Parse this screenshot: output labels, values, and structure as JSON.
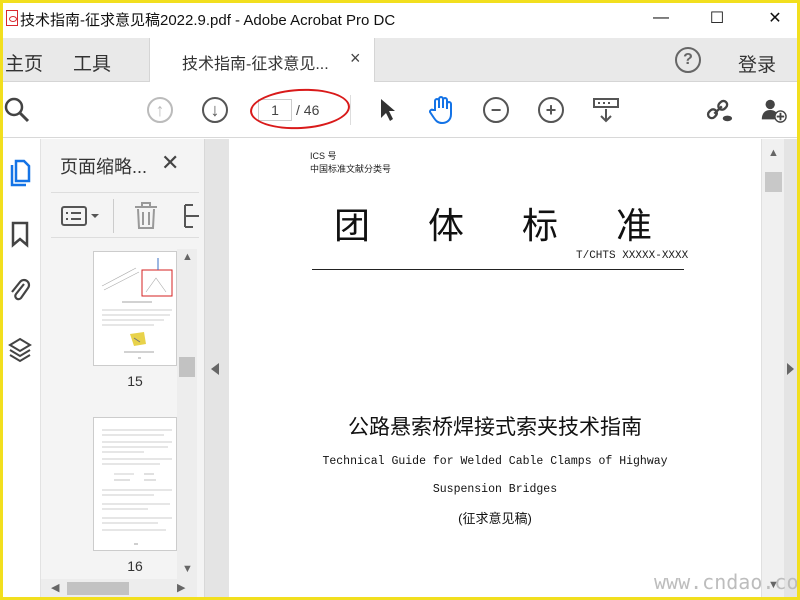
{
  "window": {
    "title": "技术指南-征求意见稿2022.9.pdf - Adobe Acrobat Pro DC",
    "minimize_glyph": "—",
    "maximize_glyph": "☐",
    "close_glyph": "✕"
  },
  "tabs": {
    "home": "主页",
    "tools": "工具",
    "document": "技术指南-征求意见...",
    "doc_close": "×",
    "help": "?",
    "login": "登录"
  },
  "toolbar": {
    "current_page": "1",
    "total_pages": "/ 46",
    "icons": [
      "search-icon",
      "previous-page-icon",
      "next-page-icon",
      "select-cursor-icon",
      "hand-tool-icon",
      "zoom-out-icon",
      "zoom-in-icon",
      "page-display-icon",
      "share-link-icon",
      "add-user-icon"
    ]
  },
  "thumbnails_panel": {
    "title": "页面缩略...",
    "close": "✕",
    "pages": [
      {
        "number": "15"
      },
      {
        "number": "16"
      }
    ]
  },
  "document": {
    "ics": "ICS 号",
    "classification": "中国标准文献分类号",
    "big_title": "团体标准",
    "standard_code": "T/CHTS XXXXX-XXXX",
    "title_cn": "公路悬索桥焊接式索夹技术指南",
    "title_en_line1": "Technical Guide for Welded Cable Clamps of Highway",
    "title_en_line2": "Suspension Bridges",
    "draft_label": "(征求意见稿)"
  },
  "watermark": "www.cndao.com",
  "colors": {
    "accent_blue": "#1473e6",
    "annotation_red": "#d91a1a",
    "frame_yellow": "#f2df1e"
  }
}
